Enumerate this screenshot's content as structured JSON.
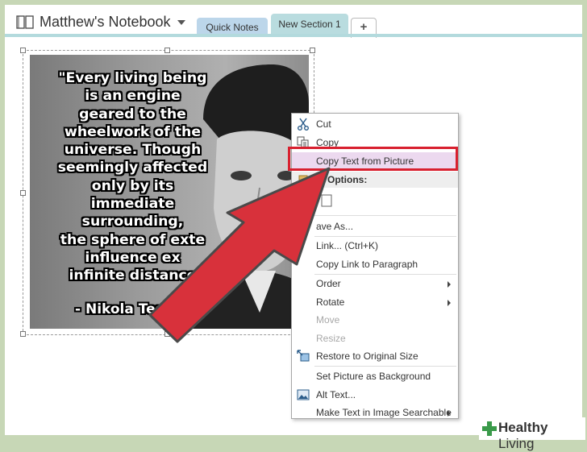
{
  "header": {
    "notebook_title": "Matthew's Notebook",
    "tabs": [
      {
        "label": "Quick Notes"
      },
      {
        "label": "New Section 1"
      },
      {
        "label": "+"
      }
    ]
  },
  "picture": {
    "quote": "\"Every living being\nis an engine\ngeared to the\nwheelwork of the\nuniverse. Though\nseemingly affected\nonly by its\nimmediate\nsurrounding,\nthe sphere of exte\ninfluence ex\ninfinite distance",
    "author": "- Nikola Tesla"
  },
  "context_menu": {
    "items": [
      {
        "label": "Cut",
        "icon": "scissors-icon",
        "enabled": true
      },
      {
        "label": "Copy",
        "icon": "copy-icon",
        "enabled": true
      },
      {
        "label": "Copy Text from Picture",
        "enabled": true,
        "highlighted": true
      },
      {
        "label": "te Options:",
        "section_header": true
      },
      {
        "label": "ave As...",
        "enabled": true
      },
      {
        "label": "Link...  (Ctrl+K)",
        "enabled": true
      },
      {
        "label": "Copy Link to Paragraph",
        "enabled": true
      },
      {
        "label": "Order",
        "enabled": true,
        "submenu": true
      },
      {
        "label": "Rotate",
        "enabled": true,
        "submenu": true
      },
      {
        "label": "Move",
        "enabled": false
      },
      {
        "label": "Resize",
        "enabled": false
      },
      {
        "label": "Restore to Original Size",
        "icon": "restore-size-icon",
        "enabled": true
      },
      {
        "label": "Set Picture as Background",
        "enabled": true
      },
      {
        "label": "Alt Text...",
        "icon": "alt-text-icon",
        "enabled": true
      },
      {
        "label": "Make Text in Image Searchable",
        "enabled": true,
        "submenu": true
      }
    ]
  },
  "watermark": {
    "brand": "Healthy Living",
    "brand_bold": "Healthy",
    "brand_rest": " Living"
  },
  "colors": {
    "arrow_fill": "#d8313b",
    "highlight_box": "#d8202f",
    "menu_highlight": "#ecd9ef",
    "tab_strip": "#b3dadd",
    "background_frame": "#c7d7b6"
  }
}
